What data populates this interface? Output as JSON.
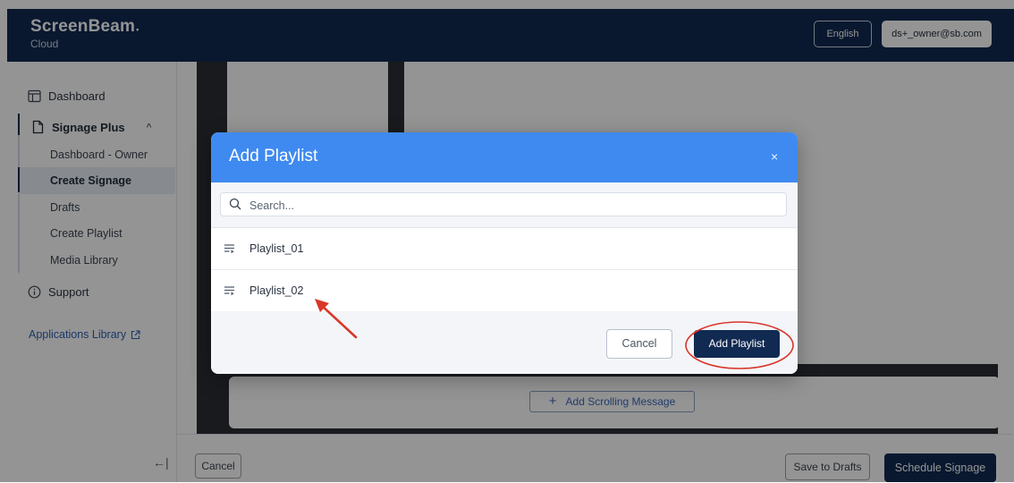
{
  "header": {
    "brand_name": "ScreenBeam",
    "brand_sub": "Cloud",
    "language": "English",
    "user": "ds+_owner@sb.com"
  },
  "sidebar": {
    "dashboard": "Dashboard",
    "signage_plus": "Signage Plus",
    "sub_items": [
      "Dashboard - Owner",
      "Create Signage",
      "Drafts",
      "Create Playlist",
      "Media Library"
    ],
    "support": "Support",
    "applications_library": "Applications Library",
    "collapse_icon": "collapse-left-icon"
  },
  "main": {
    "add_scrolling_message": "Add Scrolling Message",
    "footer": {
      "cancel": "Cancel",
      "save_to_drafts": "Save to Drafts",
      "schedule_signage": "Schedule Signage"
    }
  },
  "modal": {
    "title": "Add Playlist",
    "close": "×",
    "search_placeholder": "Search...",
    "playlists": [
      "Playlist_01",
      "Playlist_02"
    ],
    "cancel": "Cancel",
    "add": "Add Playlist"
  },
  "colors": {
    "header_bg": "#112a52",
    "modal_header": "#3f8af0",
    "primary_button": "#112a52",
    "annotation": "#d9362b"
  }
}
